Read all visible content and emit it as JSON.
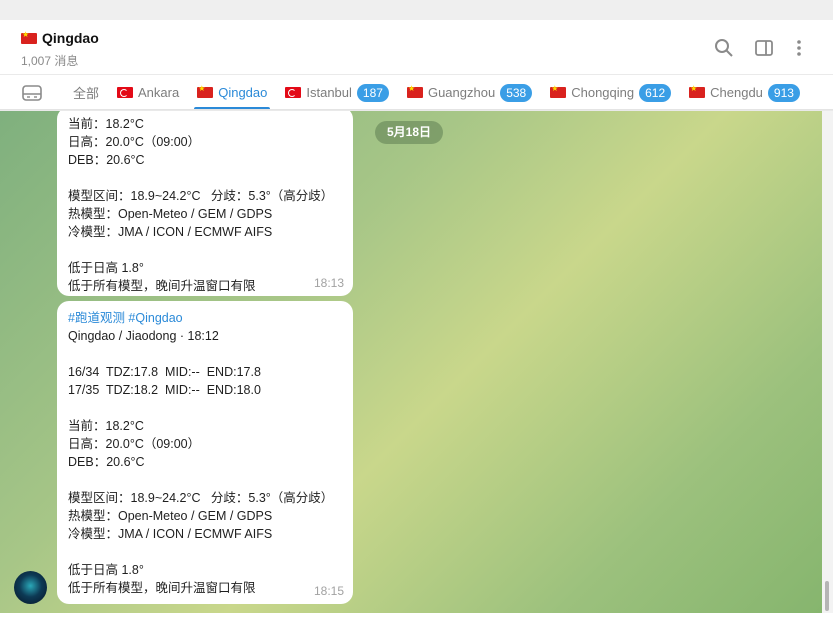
{
  "header": {
    "title": "Qingdao",
    "subtitle": "1,007 消息",
    "icons": [
      "search-icon",
      "sidebar-toggle-icon",
      "more-vertical-icon"
    ]
  },
  "tabs": [
    {
      "label": "全部",
      "flag": "",
      "badge": "",
      "active": false
    },
    {
      "label": "Ankara",
      "flag": "tr",
      "badge": "",
      "active": false
    },
    {
      "label": "Qingdao",
      "flag": "cn",
      "badge": "",
      "active": true
    },
    {
      "label": "Istanbul",
      "flag": "tr",
      "badge": "187",
      "active": false
    },
    {
      "label": "Guangzhou",
      "flag": "cn",
      "badge": "538",
      "active": false
    },
    {
      "label": "Chongqing",
      "flag": "cn",
      "badge": "612",
      "active": false
    },
    {
      "label": "Chengdu",
      "flag": "cn",
      "badge": "913",
      "active": false
    }
  ],
  "chat": {
    "date_pill": "5月18日",
    "messages": [
      {
        "lines": [
          "当前：18.2°C",
          "日高：20.0°C（09:00）",
          "DEB：20.6°C",
          "",
          "模型区间：18.9~24.2°C   分歧：5.3°（高分歧）",
          "热模型：Open-Meteo / GEM / GDPS",
          "冷模型：JMA / ICON / ECMWF AIFS",
          "",
          "低于日高 1.8°",
          "低于所有模型，晚间升温窗口有限"
        ],
        "time": "18:13"
      },
      {
        "tags": "#跑道观测 #Qingdao",
        "lines": [
          "Qingdao / Jiaodong · 18:12",
          "",
          "16/34  TDZ:17.8  MID:--  END:17.8",
          "17/35  TDZ:18.2  MID:--  END:18.0",
          "",
          "当前：18.2°C",
          "日高：20.0°C（09:00）",
          "DEB：20.6°C",
          "",
          "模型区间：18.9~24.2°C   分歧：5.3°（高分歧）",
          "热模型：Open-Meteo / GEM / GDPS",
          "冷模型：JMA / ICON / ECMWF AIFS",
          "",
          "低于日高 1.8°",
          "低于所有模型，晚间升温窗口有限"
        ],
        "time": "18:15"
      }
    ]
  },
  "colors": {
    "accent": "#2b8ad8",
    "badge": "#3a9ee6",
    "bubble": "#ffffff"
  }
}
